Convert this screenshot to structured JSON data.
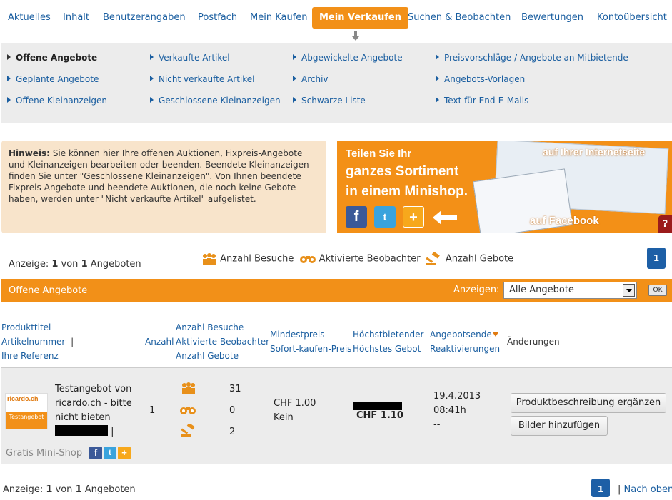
{
  "nav": {
    "items": [
      "Aktuelles",
      "Inhalt",
      "Benutzerangaben",
      "Postfach",
      "Mein Kaufen",
      "Mein Verkaufen",
      "Suchen & Beobachten",
      "Bewertungen",
      "Kontoübersicht"
    ],
    "active": "Mein Verkaufen"
  },
  "submenu": {
    "col1": [
      "Offene Angebote",
      "Geplante Angebote",
      "Offene Kleinanzeigen"
    ],
    "col2": [
      "Verkaufte Artikel",
      "Nicht verkaufte Artikel",
      "Geschlossene Kleinanzeigen"
    ],
    "col3": [
      "Abgewickelte Angebote",
      "Archiv",
      "Schwarze Liste"
    ],
    "col4": [
      "Preisvorschläge / Angebote an Mitbietende",
      "Angebots-Vorlagen",
      "Text für End-E-Mails"
    ],
    "current": "Offene Angebote"
  },
  "hint": {
    "label": "Hinweis:",
    "text": "Sie können hier Ihre offenen Auktionen, Fixpreis-Angebote und Kleinanzeigen bearbeiten oder beenden. Beendete Kleinanzeigen finden Sie unter \"Geschlossene Kleinanzeigen\". Von Ihnen beendete Fixpreis-Angebote und beendete Auktionen, die noch keine Gebote haben, werden unter \"Nicht verkaufte Artikel\" aufgelistet."
  },
  "banner": {
    "line1": "Teilen Sie Ihr",
    "line2": "ganzes Sortiment",
    "line3": "in einem Minishop.",
    "right_top": "auf Ihrer Internetseite",
    "right_bottom": "auf Facebook",
    "help": "?"
  },
  "count": {
    "prefix": "Anzeige:",
    "current": "1",
    "of": "von",
    "total": "1",
    "suffix": "Angeboten"
  },
  "legend": {
    "visits": "Anzahl Besuche",
    "watchers": "Aktivierte Beobachter",
    "bids": "Anzahl Gebote"
  },
  "pagination": {
    "page": "1",
    "to_top": "Nach oben",
    "separator": "|"
  },
  "table": {
    "title": "Offene Angebote",
    "filter_label": "Anzeigen:",
    "filter_value": "Alle Angebote",
    "ok_label": "OK",
    "headers": {
      "product_title": "Produkttitel",
      "article_number": "Artikelnummer",
      "sep": "|",
      "your_reference": "Ihre Referenz",
      "quantity": "Anzahl",
      "visits": "Anzahl Besuche",
      "watchers": "Aktivierte Beobachter",
      "bids": "Anzahl Gebote",
      "min_price": "Mindestpreis",
      "buy_now": "Sofort-kaufen-Preis",
      "high_bidder": "Höchstbietender",
      "high_bid": "Höchstes Gebot",
      "end": "Angebotsende",
      "reactivations": "Reaktivierungen",
      "changes": "Änderungen"
    },
    "row": {
      "thumb_logo": "ricardo.ch",
      "thumb_label": "Testangebot",
      "title_line1": "Testangebot von",
      "title_line2": "ricardo.ch - bitte",
      "title_line3": "nicht bieten",
      "title_sep": "|",
      "quantity": "1",
      "visits": "31",
      "watchers": "0",
      "bids": "2",
      "min_price": "CHF 1.00",
      "buy_now": "Kein",
      "high_bid": "CHF 1.10",
      "end_date": "19.4.2013",
      "end_time": "08:41h",
      "reactivations": "--",
      "btn_description": "Produktbeschreibung ergänzen",
      "btn_images": "Bilder hinzufügen",
      "minishop": "Gratis Mini-Shop"
    }
  },
  "colors": {
    "accent": "#f29018",
    "link": "#1a5ea0",
    "page_button": "#1d5fa6"
  }
}
